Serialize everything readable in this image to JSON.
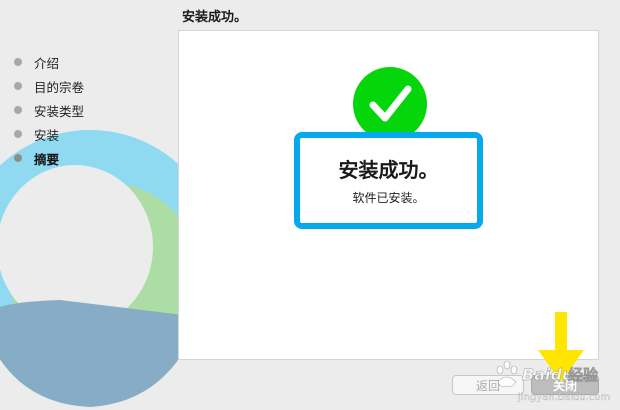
{
  "header": {
    "title": "安装成功。"
  },
  "sidebar": {
    "steps": [
      {
        "label": "介绍"
      },
      {
        "label": "目的宗卷"
      },
      {
        "label": "安装类型"
      },
      {
        "label": "安装"
      },
      {
        "label": "摘要"
      }
    ],
    "current_step": "摘要"
  },
  "main": {
    "status_icon": "checkmark-circle-icon",
    "success_title": "安装成功。",
    "success_subtitle": "软件已安装。"
  },
  "buttons": {
    "back_label": "返回",
    "close_label": "关闭"
  },
  "colors": {
    "check_green": "#05d60b",
    "highlight_blue": "#06a9ec",
    "arrow_yellow": "#ffe600"
  },
  "watermark": {
    "text": "Baidu 经验",
    "domain": "jingyan.baidu.com"
  }
}
